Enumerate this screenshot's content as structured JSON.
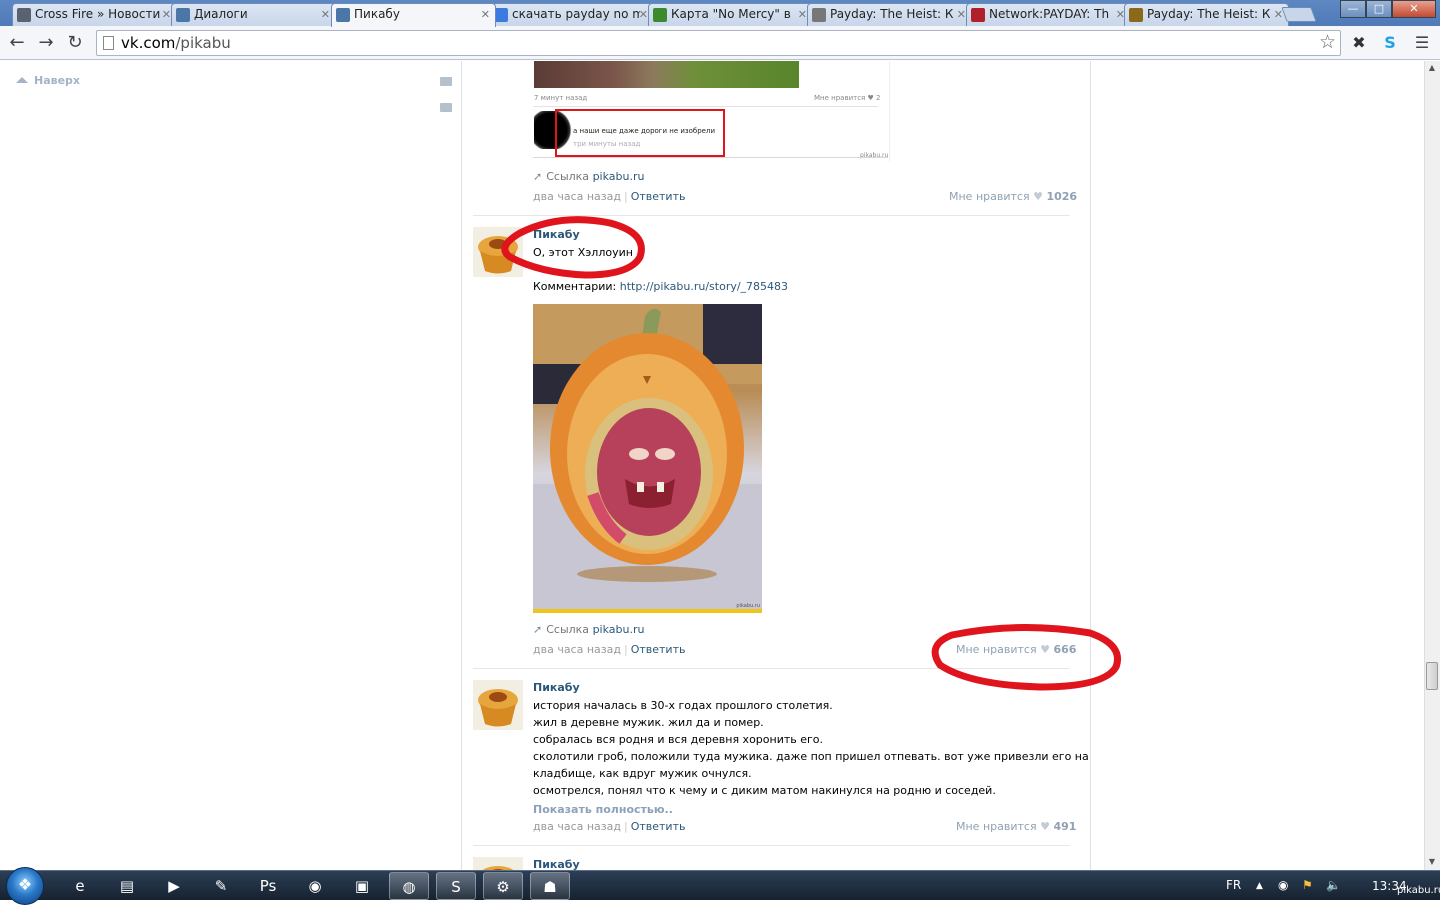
{
  "browser": {
    "tabs": [
      {
        "label": "Cross Fire » Новости",
        "icon": "crossfire-icon",
        "color": "#5a6270"
      },
      {
        "label": "Диалоги",
        "icon": "vk-dialogs-icon",
        "color": "#4a76a8"
      },
      {
        "label": "Пикабу",
        "icon": "vk-icon",
        "color": "#4a76a8"
      },
      {
        "label": "скачать payday no m",
        "icon": "google-icon",
        "color": "#3b7be0"
      },
      {
        "label": "Карта \"No Mercy\" в",
        "icon": "z-site-icon",
        "color": "#3c8a2e"
      },
      {
        "label": "Payday: The Heist: К",
        "icon": "payday-icon",
        "color": "#777777"
      },
      {
        "label": "Network:PAYDAY: Th",
        "icon": "network-icon",
        "color": "#b0202a"
      },
      {
        "label": "Payday: The Heist: К",
        "icon": "payday-mask-icon",
        "color": "#8a6a1a"
      }
    ],
    "window_buttons": {
      "minimize": "—",
      "maximize": "□",
      "close": "✕"
    },
    "url_domain": "vk.com",
    "url_path": "/pikabu"
  },
  "page": {
    "top_button": "Наверх",
    "posts": [
      {
        "embedded": {
          "time": "7 минут назад",
          "likes": "Мне нравится ♥ 2",
          "comment": "а наши еще даже дороги не изобрели",
          "comment_time": "три минуты назад",
          "watermark": "pikabu.ru"
        },
        "link_prefix": "Ссылка",
        "link": "pikabu.ru",
        "time": "два часа назад",
        "reply": "Ответить",
        "likes_label": "Мне нравится",
        "likes_count": "1026"
      },
      {
        "author": "Пикабу",
        "text": "О, этот Хэллоуин",
        "comments_label": "Комментарии:",
        "comments_url": "http://pikabu.ru/story/_785483",
        "image_watermark": "pikabu.ru",
        "link_prefix": "Ссылка",
        "link": "pikabu.ru",
        "time": "два часа назад",
        "reply": "Ответить",
        "likes_label": "Мне нравится",
        "likes_count": "666"
      },
      {
        "author": "Пикабу",
        "lines": [
          "история началась в 30-х годах прошлого столетия.",
          "жил в деревне мужик. жил да и помер.",
          "собралась вся родня и вся деревня хоронить его.",
          "сколотили гроб, положили туда мужика. даже поп пришел отпевать. вот уже привезли его на",
          "кладбище, как вдруг мужик очнулся.",
          "осмотрелся, понял что к чему и с диким матом накинулся на родню и соседей."
        ],
        "show_more": "Показать полностью..",
        "time": "два часа назад",
        "reply": "Ответить",
        "likes_label": "Мне нравится",
        "likes_count": "491"
      },
      {
        "author": "Пикабу"
      }
    ]
  },
  "taskbar": {
    "language": "FR",
    "clock": "13:34",
    "watermark": "pikabu.ru",
    "apps": [
      {
        "name": "ie-icon",
        "glyph": "e",
        "open": false
      },
      {
        "name": "explorer-icon",
        "glyph": "▤",
        "open": false
      },
      {
        "name": "media-player-icon",
        "glyph": "▶",
        "open": false
      },
      {
        "name": "tool-icon",
        "glyph": "✎",
        "open": false
      },
      {
        "name": "photoshop-icon",
        "glyph": "Ps",
        "open": false
      },
      {
        "name": "globe-app-icon",
        "glyph": "◉",
        "open": false
      },
      {
        "name": "app-icon",
        "glyph": "▣",
        "open": false
      },
      {
        "name": "chrome-icon",
        "glyph": "◍",
        "open": true
      },
      {
        "name": "skype-icon",
        "glyph": "S",
        "open": true
      },
      {
        "name": "steam-icon",
        "glyph": "⚙",
        "open": true
      },
      {
        "name": "game-icon",
        "glyph": "☗",
        "open": true
      }
    ]
  },
  "colors": {
    "link_blue": "#2b587a",
    "annotation_red": "#e0141c",
    "meta_gray": "#999999"
  }
}
